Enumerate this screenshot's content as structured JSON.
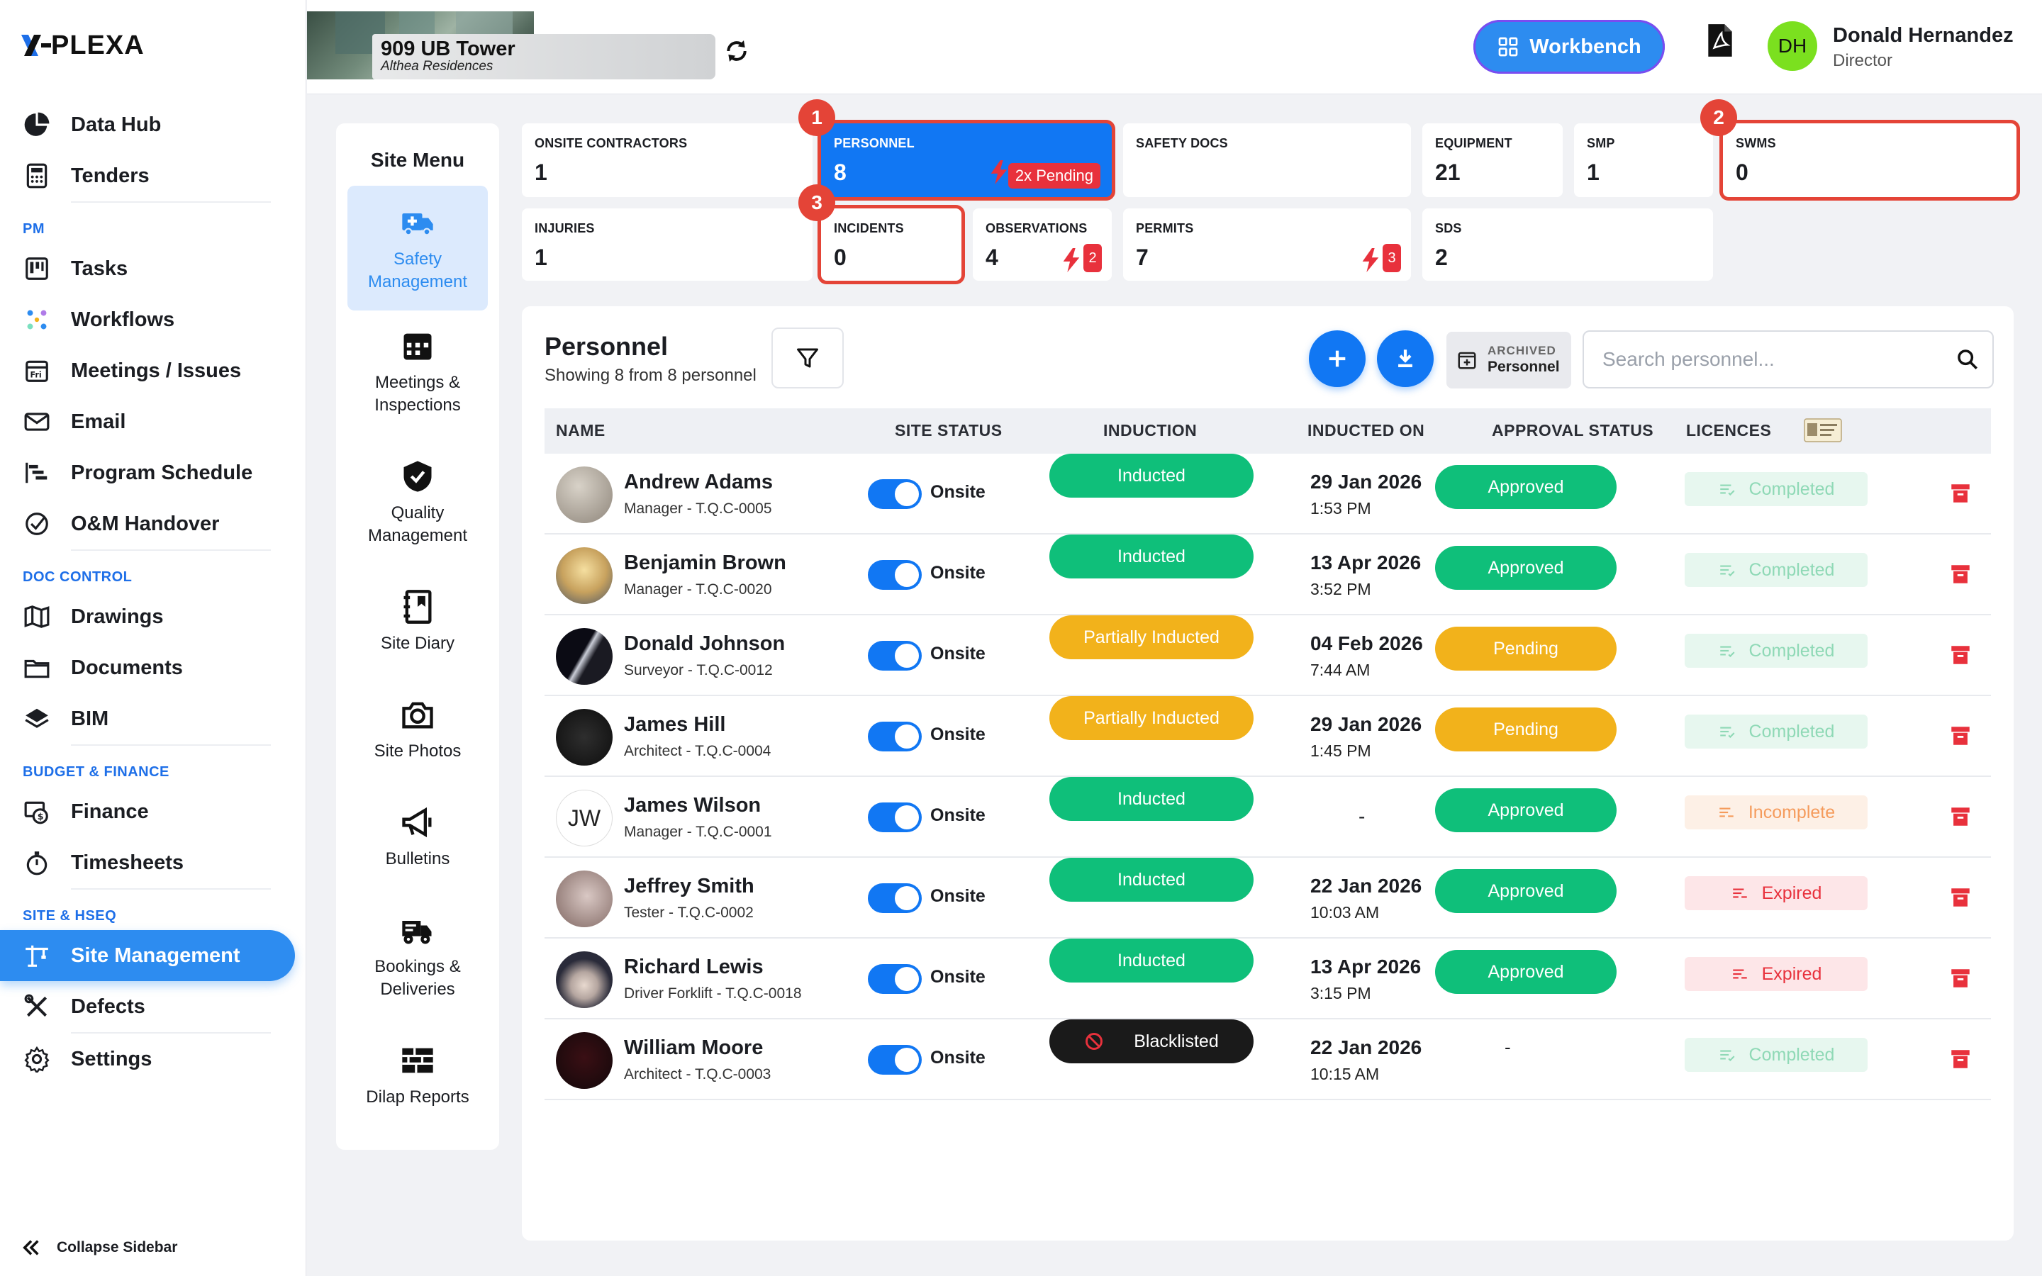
{
  "brand": {
    "logo_text": "PLEXA",
    "accent": "#1177f3",
    "danger": "#e8313c",
    "success": "#0fbf7a",
    "warning": "#f2b21b"
  },
  "sidebar": {
    "items_top": [
      {
        "label": "Data Hub",
        "icon": "pie-chart-icon"
      },
      {
        "label": "Tenders",
        "icon": "calculator-icon"
      }
    ],
    "sections": [
      {
        "title": "PM",
        "items": [
          {
            "label": "Tasks",
            "icon": "kanban-icon"
          },
          {
            "label": "Workflows",
            "icon": "workflow-icon"
          },
          {
            "label": "Meetings / Issues",
            "icon": "calendar-icon"
          },
          {
            "label": "Email",
            "icon": "envelope-icon"
          },
          {
            "label": "Program Schedule",
            "icon": "gantt-icon"
          },
          {
            "label": "O&M Handover",
            "icon": "check-badge-icon"
          }
        ]
      },
      {
        "title": "DOC CONTROL",
        "items": [
          {
            "label": "Drawings",
            "icon": "map-icon"
          },
          {
            "label": "Documents",
            "icon": "folder-icon"
          },
          {
            "label": "BIM",
            "icon": "layers-icon"
          }
        ]
      },
      {
        "title": "BUDGET & FINANCE",
        "items": [
          {
            "label": "Finance",
            "icon": "money-icon"
          },
          {
            "label": "Timesheets",
            "icon": "stopwatch-icon"
          }
        ]
      },
      {
        "title": "SITE & HSEQ",
        "items": [
          {
            "label": "Site Management",
            "icon": "crane-icon",
            "active": true
          },
          {
            "label": "Defects",
            "icon": "tools-icon"
          },
          {
            "label": "Settings",
            "icon": "gear-icon"
          }
        ]
      }
    ],
    "collapse_label": "Collapse Sidebar"
  },
  "header": {
    "project_name": "909 UB Tower",
    "project_sub": "Althea Residences",
    "workbench_label": "Workbench",
    "user_initials": "DH",
    "user_name": "Donald Hernandez",
    "user_role": "Director"
  },
  "site_menu": {
    "title": "Site Menu",
    "items": [
      {
        "label": "Safety Management",
        "icon": "medical-truck-icon",
        "active": true
      },
      {
        "label": "Meetings & Inspections",
        "icon": "calendar-grid-icon"
      },
      {
        "label": "Quality Management",
        "icon": "shield-check-icon"
      },
      {
        "label": "Site Diary",
        "icon": "diary-icon"
      },
      {
        "label": "Site Photos",
        "icon": "camera-icon"
      },
      {
        "label": "Bulletins",
        "icon": "megaphone-icon"
      },
      {
        "label": "Bookings & Deliveries",
        "icon": "delivery-truck-icon"
      },
      {
        "label": "Dilap Reports",
        "icon": "brick-wall-icon"
      }
    ]
  },
  "stats": {
    "onsite_contractors": {
      "label": "ONSITE CONTRACTORS",
      "value": "1"
    },
    "personnel": {
      "label": "PERSONNEL",
      "value": "8",
      "pending": "2x Pending",
      "step": "1"
    },
    "safety_docs": {
      "label": "SAFETY DOCS",
      "value": ""
    },
    "equipment": {
      "label": "EQUIPMENT",
      "value": "21"
    },
    "smp": {
      "label": "SMP",
      "value": "1"
    },
    "swms": {
      "label": "SWMS",
      "value": "0",
      "step": "2"
    },
    "injuries": {
      "label": "INJURIES",
      "value": "1"
    },
    "incidents": {
      "label": "INCIDENTS",
      "value": "0",
      "step": "3"
    },
    "observations": {
      "label": "OBSERVATIONS",
      "value": "4",
      "badge": "2"
    },
    "permits": {
      "label": "PERMITS",
      "value": "7",
      "badge": "3"
    },
    "sds": {
      "label": "SDS",
      "value": "2"
    }
  },
  "personnel": {
    "title": "Personnel",
    "subtitle": "Showing 8 from 8 personnel",
    "archived_top": "ARCHIVED",
    "archived_bottom": "Personnel",
    "search_placeholder": "Search personnel...",
    "columns": [
      "NAME",
      "SITE STATUS",
      "INDUCTION",
      "INDUCTED ON",
      "APPROVAL STATUS",
      "LICENCES"
    ],
    "rows": [
      {
        "name": "Andrew Adams",
        "role": "Manager - T.Q.C-0005",
        "site_status": "Onsite",
        "induction": "Inducted",
        "date": "29 Jan 2026",
        "time": "1:53 PM",
        "approval": "Approved",
        "licence": "Completed"
      },
      {
        "name": "Benjamin Brown",
        "role": "Manager - T.Q.C-0020",
        "site_status": "Onsite",
        "induction": "Inducted",
        "date": "13 Apr 2026",
        "time": "3:52 PM",
        "approval": "Approved",
        "licence": "Completed"
      },
      {
        "name": "Donald Johnson",
        "role": "Surveyor - T.Q.C-0012",
        "site_status": "Onsite",
        "induction": "Partially Inducted",
        "date": "04 Feb 2026",
        "time": "7:44 AM",
        "approval": "Pending",
        "licence": "Completed"
      },
      {
        "name": "James Hill",
        "role": "Architect - T.Q.C-0004",
        "site_status": "Onsite",
        "induction": "Partially Inducted",
        "date": "29 Jan 2026",
        "time": "1:45 PM",
        "approval": "Pending",
        "licence": "Completed"
      },
      {
        "name": "James Wilson",
        "initials": "JW",
        "role": "Manager - T.Q.C-0001",
        "site_status": "Onsite",
        "induction": "Inducted",
        "date": "-",
        "time": "",
        "approval": "Approved",
        "licence": "Incomplete"
      },
      {
        "name": "Jeffrey Smith",
        "role": "Tester - T.Q.C-0002",
        "site_status": "Onsite",
        "induction": "Inducted",
        "date": "22 Jan 2026",
        "time": "10:03 AM",
        "approval": "Approved",
        "licence": "Expired"
      },
      {
        "name": "Richard Lewis",
        "role": "Driver Forklift - T.Q.C-0018",
        "site_status": "Onsite",
        "induction": "Inducted",
        "date": "13 Apr 2026",
        "time": "3:15 PM",
        "approval": "Approved",
        "licence": "Expired"
      },
      {
        "name": "William Moore",
        "role": "Architect - T.Q.C-0003",
        "site_status": "Onsite",
        "induction": "Blacklisted",
        "date": "22 Jan 2026",
        "time": "10:15 AM",
        "approval": "-",
        "licence": "Completed"
      }
    ]
  }
}
